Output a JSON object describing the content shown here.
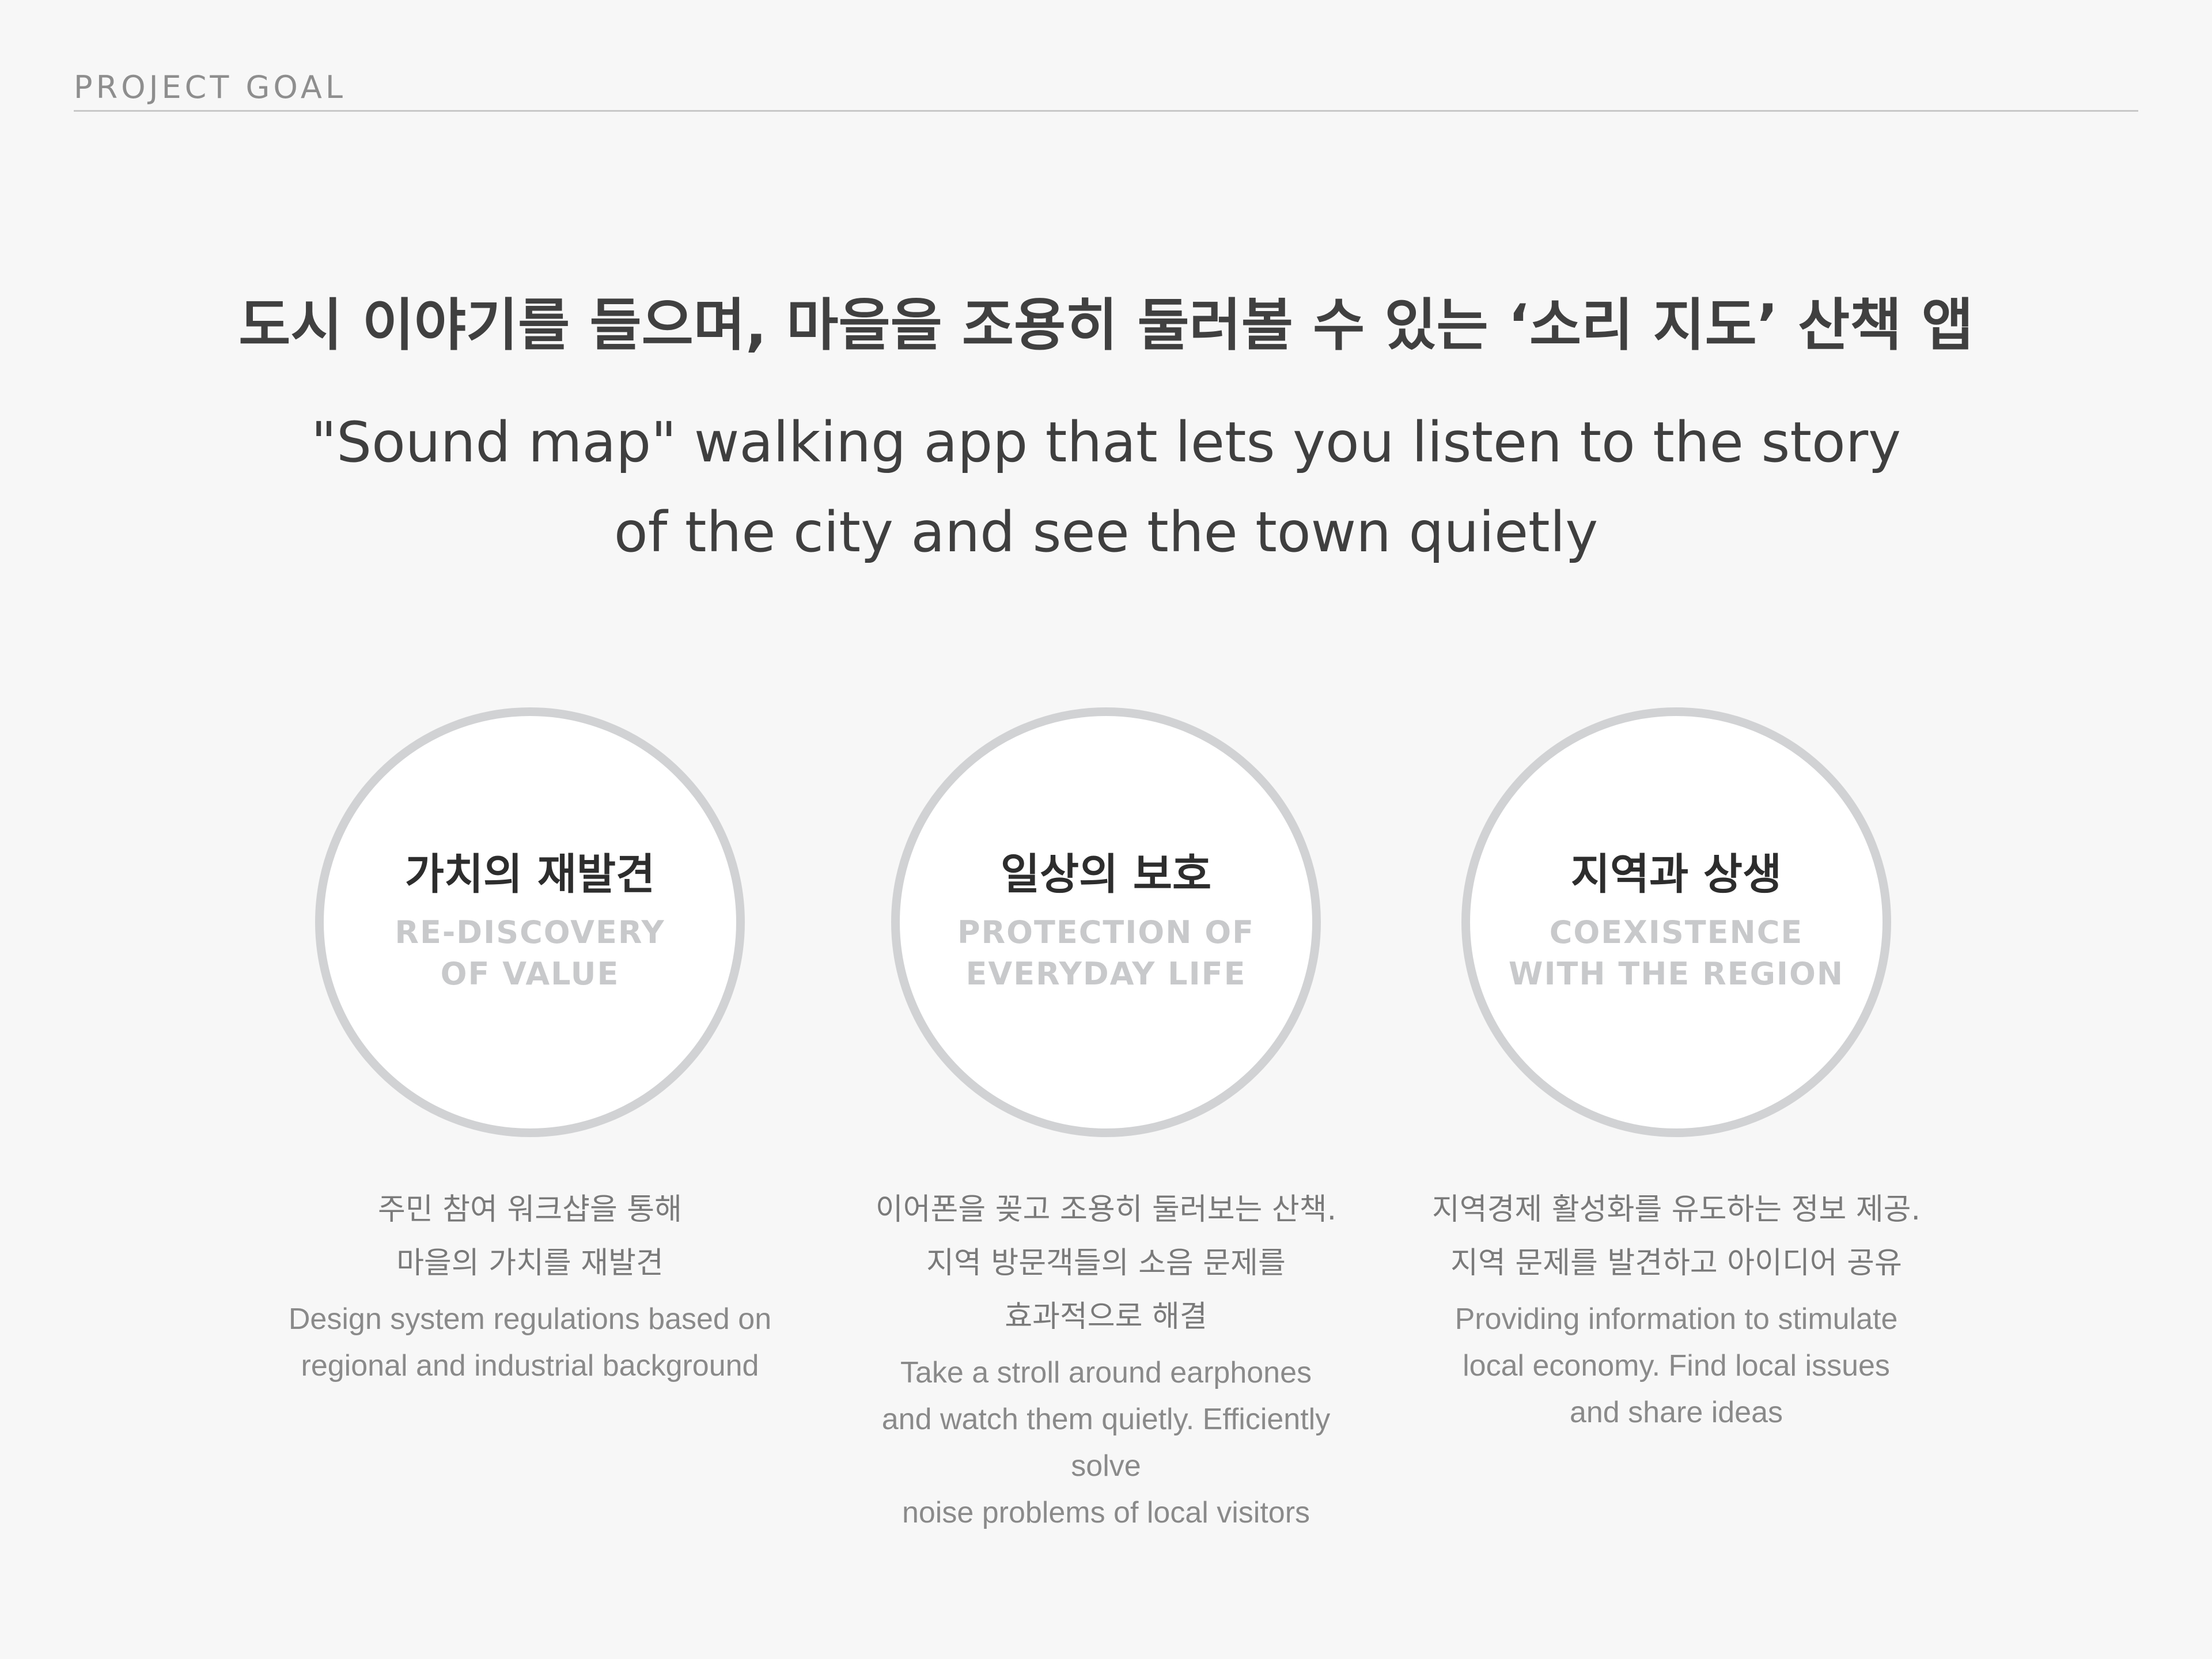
{
  "header": {
    "section_label": "PROJECT GOAL"
  },
  "headline": {
    "korean": "도시 이야기를 들으며, 마을을 조용히 둘러볼 수 있는 ‘소리 지도’ 산책 앱",
    "english_line1": "\"Sound map\" walking app that lets you listen to the story",
    "english_line2": "of the city and see the town quietly"
  },
  "goals": [
    {
      "title_ko": "가치의 재발견",
      "title_en_line1": "RE-DISCOVERY",
      "title_en_line2": "OF VALUE",
      "desc_ko_line1": "주민 참여 워크샵을 통해",
      "desc_ko_line2": "마을의 가치를 재발견",
      "desc_en_line1": "Design system regulations based on",
      "desc_en_line2": "regional and industrial background"
    },
    {
      "title_ko": "일상의 보호",
      "title_en_line1": "PROTECTION OF",
      "title_en_line2": "EVERYDAY LIFE",
      "desc_ko_line1": "이어폰을 꽂고 조용히 둘러보는 산책.",
      "desc_ko_line2": "지역 방문객들의 소음 문제를",
      "desc_ko_line3": "효과적으로 해결",
      "desc_en_line1": "Take a stroll around earphones",
      "desc_en_line2": "and watch them quietly. Efficiently solve",
      "desc_en_line3": "noise problems of local visitors"
    },
    {
      "title_ko": "지역과 상생",
      "title_en_line1": "COEXISTENCE",
      "title_en_line2": "WITH THE REGION",
      "desc_ko_line1": "지역경제 활성화를 유도하는 정보 제공.",
      "desc_ko_line2": "지역 문제를 발견하고 아이디어 공유",
      "desc_en_line1": "Providing information to stimulate",
      "desc_en_line2": "local economy. Find local issues",
      "desc_en_line3": "and share ideas"
    }
  ]
}
